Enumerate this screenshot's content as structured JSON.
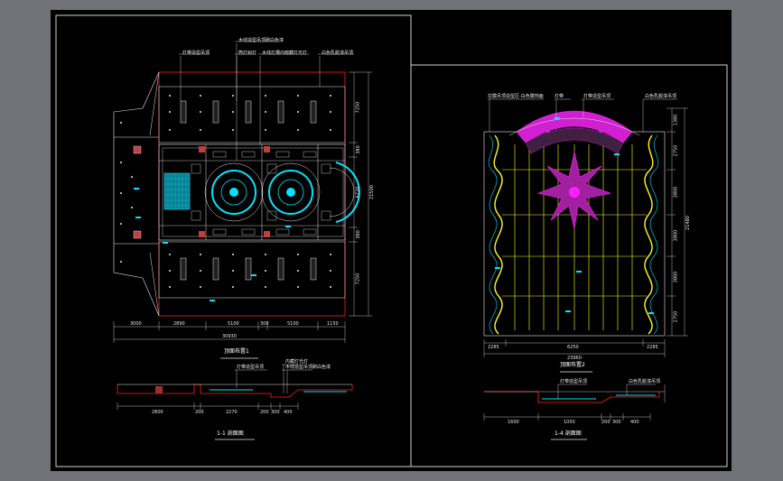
{
  "colors": {
    "background": "#6f7378",
    "paper": "#000000",
    "frame": "#d0d0d0",
    "red": "#ff2020",
    "cyan": "#00e5ff",
    "magenta": "#ff20ff",
    "yellow": "#ffff20",
    "green": "#20ff20",
    "white": "#e6e6e6"
  },
  "left_plan": {
    "title": "顶面布置1",
    "callouts": [
      "灯带造型吊顶",
      "木线造型吊顶刷白色漆",
      "筒灯射灯",
      "木线灯槽内暗藏灯光灯",
      "白色乳胶漆吊顶"
    ],
    "dims_bottom": [
      "3000",
      "2890",
      "5100",
      "300",
      "5100",
      "1150"
    ],
    "dim_total": "30930",
    "dims_right": [
      "7250",
      "380",
      "6720",
      "380",
      "7250"
    ],
    "dim_right_total": "21500"
  },
  "right_plan": {
    "title": "顶面布置2",
    "callouts": [
      "拉膜吊顶造型区-白色膜饰面",
      "灯带",
      "灯带造型吊顶",
      "白色乳胶漆吊顶"
    ],
    "dims_bottom": [
      "2285",
      "6250",
      "2285"
    ],
    "dim_total": "23960",
    "dims_right": [
      "1380",
      "2750",
      "3800",
      "3800",
      "3800",
      "2750"
    ],
    "dim_right_total": "21480"
  },
  "section_left": {
    "title": "1-1 剖面图",
    "callouts": [
      "灯带造型吊顶",
      "内藏灯光灯",
      "木线造型吊顶刷白色漆"
    ],
    "dims": [
      "2800",
      "200",
      "2270",
      "200",
      "300",
      "400"
    ]
  },
  "section_right": {
    "title": "1-4 剖面图",
    "callouts": [
      "灯带造型吊顶",
      "白色乳胶漆吊顶"
    ],
    "dims": [
      "1600",
      "1050",
      "200",
      "300",
      "400"
    ]
  }
}
